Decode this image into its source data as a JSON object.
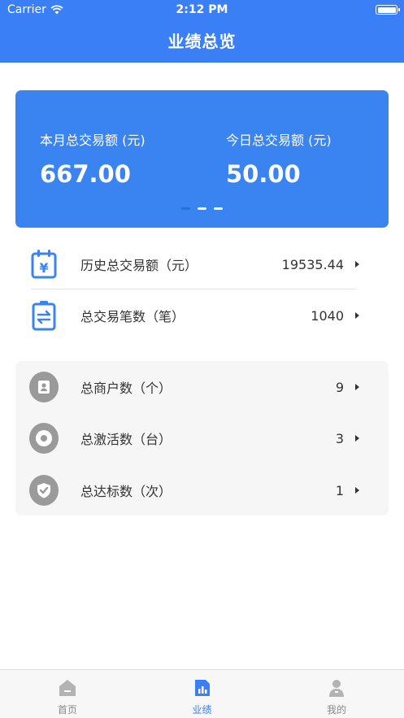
{
  "status_bar": {
    "carrier": "Carrier",
    "time": "2:12 PM"
  },
  "nav": {
    "title": "业绩总览"
  },
  "summary": {
    "month_label": "本月总交易额 (元)",
    "month_value": "667.00",
    "today_label": "今日总交易额 (元)",
    "today_value": "50.00"
  },
  "stats": [
    {
      "label": "历史总交易额（元）",
      "value": "19535.44",
      "icon": "calendar-yen-icon"
    },
    {
      "label": "总交易笔数（笔）",
      "value": "1040",
      "icon": "transfer-battery-icon"
    }
  ],
  "group_stats": [
    {
      "label": "总商户数（个）",
      "value": "9",
      "icon": "merchant-icon"
    },
    {
      "label": "总激活数（台）",
      "value": "3",
      "icon": "activation-icon"
    },
    {
      "label": "总达标数（次）",
      "value": "1",
      "icon": "shield-check-icon"
    }
  ],
  "tabs": [
    {
      "label": "首页",
      "icon": "home-icon"
    },
    {
      "label": "业绩",
      "icon": "chart-icon"
    },
    {
      "label": "我的",
      "icon": "profile-icon"
    }
  ],
  "colors": {
    "primary": "#3a7ff6",
    "card": "#3a84f2",
    "icon_gray": "#9a9a9a"
  }
}
